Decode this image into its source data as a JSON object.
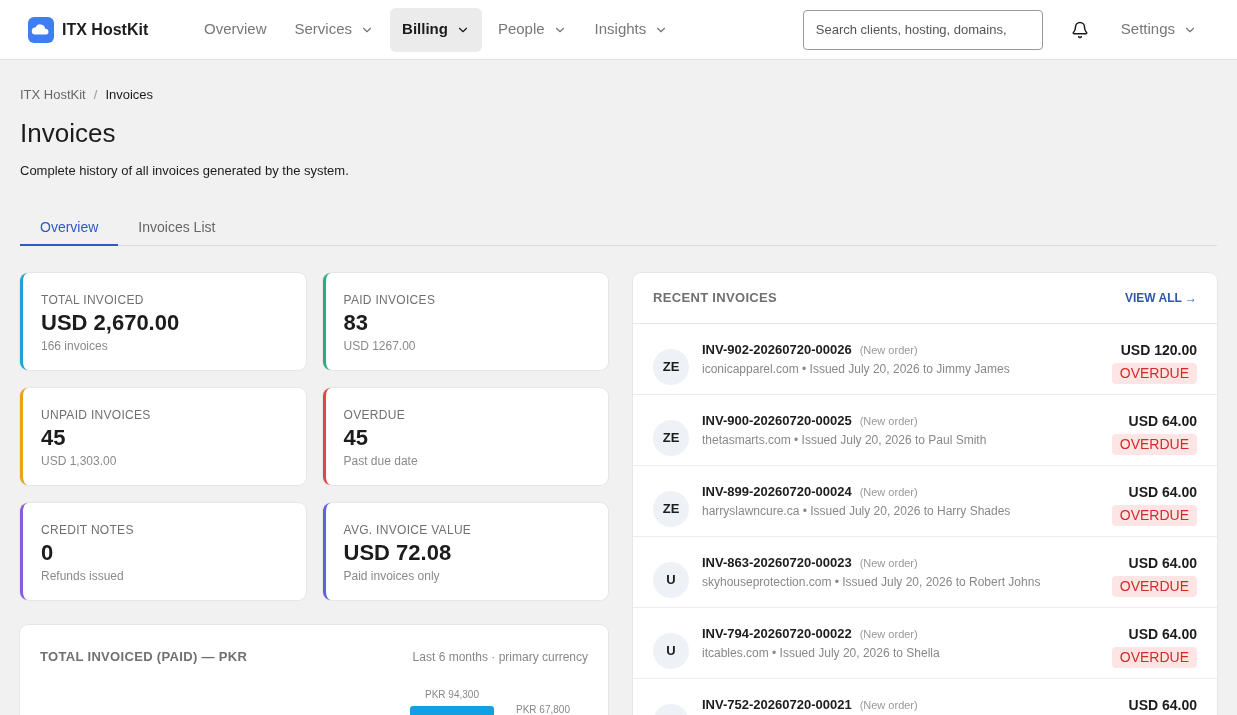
{
  "brand": {
    "name": "ITX HostKit"
  },
  "nav": [
    {
      "label": "Overview",
      "selected": false,
      "dropdown": false
    },
    {
      "label": "Services",
      "selected": false,
      "dropdown": true
    },
    {
      "label": "Billing",
      "selected": true,
      "dropdown": true
    },
    {
      "label": "People",
      "selected": false,
      "dropdown": true
    },
    {
      "label": "Insights",
      "selected": false,
      "dropdown": true
    }
  ],
  "search": {
    "placeholder": "Search clients, hosting, domains,"
  },
  "settings": {
    "label": "Settings"
  },
  "breadcrumb": {
    "items": [
      "ITX HostKit",
      "Invoices"
    ],
    "separator": "/"
  },
  "page": {
    "title": "Invoices",
    "subtitle": "Complete history of all invoices generated by the system."
  },
  "tabs": [
    {
      "label": "Overview",
      "selected": true
    },
    {
      "label": "Invoices List",
      "selected": false
    }
  ],
  "stats": [
    {
      "label": "TOTAL INVOICED",
      "value": "USD 2,670.00",
      "note": "166 invoices",
      "color": "#1fa2d6"
    },
    {
      "label": "PAID INVOICES",
      "value": "83",
      "note": "USD 1267.00",
      "color": "#22b07d"
    },
    {
      "label": "UNPAID INVOICES",
      "value": "45",
      "note": "USD 1,303.00",
      "color": "#e8a317"
    },
    {
      "label": "OVERDUE",
      "value": "45",
      "note": "Past due date",
      "color": "#e04848"
    },
    {
      "label": "CREDIT NOTES",
      "value": "0",
      "note": "Refunds issued",
      "color": "#8a5be0"
    },
    {
      "label": "AVG. INVOICE VALUE",
      "value": "USD 72.08",
      "note": "Paid invoices only",
      "color": "#6060e0"
    }
  ],
  "chart_panel": {
    "title": "TOTAL INVOICED (PAID) — PKR",
    "subtitle": "Last 6 months · primary currency",
    "bar_labels": [
      "PKR 94,300",
      "PKR 67,800"
    ]
  },
  "recent": {
    "title": "RECENT INVOICES",
    "view_all": "VIEW ALL →",
    "rows": [
      {
        "initials": "ZE",
        "number": "INV-902-20260720-00026",
        "tag": "(New order)",
        "details": "iconicapparel.com • Issued July 20, 2026 to Jimmy James",
        "amount": "USD 120.00",
        "status": "OVERDUE"
      },
      {
        "initials": "ZE",
        "number": "INV-900-20260720-00025",
        "tag": "(New order)",
        "details": "thetasmarts.com • Issued July 20, 2026 to Paul Smith",
        "amount": "USD 64.00",
        "status": "OVERDUE"
      },
      {
        "initials": "ZE",
        "number": "INV-899-20260720-00024",
        "tag": "(New order)",
        "details": "harryslawncure.ca • Issued July 20, 2026 to Harry Shades",
        "amount": "USD 64.00",
        "status": "OVERDUE"
      },
      {
        "initials": "U",
        "number": "INV-863-20260720-00023",
        "tag": "(New order)",
        "details": "skyhouseprotection.com • Issued July 20, 2026 to Robert Johns",
        "amount": "USD 64.00",
        "status": "OVERDUE"
      },
      {
        "initials": "U",
        "number": "INV-794-20260720-00022",
        "tag": "(New order)",
        "details": "itcables.com • Issued July 20, 2026 to Shella",
        "amount": "USD 64.00",
        "status": "OVERDUE"
      },
      {
        "number": "INV-752-20260720-00021",
        "tag": "(New order)",
        "amount": "USD 64.00"
      }
    ]
  }
}
